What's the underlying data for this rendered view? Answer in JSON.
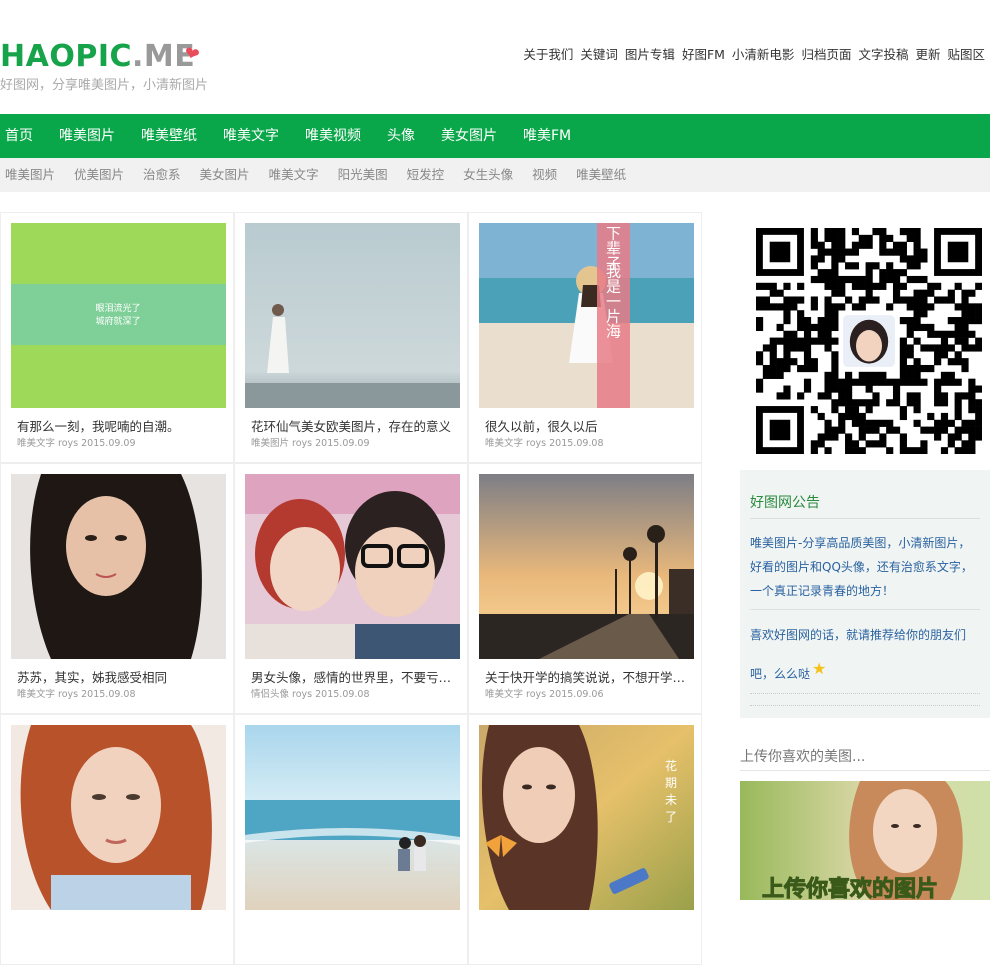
{
  "logo": {
    "brand": "HAOPIC",
    "dot_me": ".ME",
    "slogan": "好图网，分享唯美图片，小清新图片"
  },
  "top_links": [
    "关于我们",
    "关键词",
    "图片专辑",
    "好图FM",
    "小清新电影",
    "归档页面",
    "文字投稿",
    "更新",
    "贴图区"
  ],
  "main_nav": [
    "首页",
    "唯美图片",
    "唯美壁纸",
    "唯美文字",
    "唯美视频",
    "头像",
    "美女图片",
    "唯美FM"
  ],
  "sub_nav": [
    "唯美图片",
    "优美图片",
    "治愈系",
    "美女图片",
    "唯美文字",
    "阳光美图",
    "短发控",
    "女生头像",
    "视频",
    "唯美壁纸"
  ],
  "posts": [
    {
      "title": "有那么一刻，我呢喃的自潮。",
      "meta": "唯美文字 roys 2015.09.09",
      "thumb_text": [
        "眼泪流光了",
        "城府就深了"
      ]
    },
    {
      "title": "花环仙气美女欧美图片，存在的意义",
      "meta": "唯美图片 roys 2015.09.09"
    },
    {
      "title": "很久以前，很久以后",
      "meta": "唯美文字 roys 2015.09.08",
      "thumb_text": [
        "下辈子",
        "我是一片海"
      ]
    },
    {
      "title": "苏苏，其实，姊我感受相同",
      "meta": "唯美文字 roys 2015.09.08"
    },
    {
      "title": "男女头像，感情的世界里，不要亏待对你好的人",
      "meta": "情侣头像 roys 2015.09.08"
    },
    {
      "title": "关于快开学的搞笑说说，不想开学的心情说说",
      "meta": "唯美文字 roys 2015.09.06"
    },
    {
      "title": "",
      "meta": ""
    },
    {
      "title": "",
      "meta": ""
    },
    {
      "title": "",
      "meta": "",
      "thumb_text": [
        "花",
        "期",
        "未",
        "了"
      ]
    }
  ],
  "notice": {
    "heading": "好图网公告",
    "para1": "唯美图片-分享高品质美图，小清新图片，好看的图片和QQ头像，还有治愈系文字，一个真正记录青春的地方！",
    "para2": "喜欢好图网的话，就请推荐给你的朋友们吧，么么哒"
  },
  "upload": {
    "title": "上传你喜欢的美图...",
    "banner_text": "上传你喜欢的图片"
  },
  "colors": {
    "brand_green": "#0aa74a",
    "logo_gray": "#999999",
    "link_blue": "#2a62a0",
    "heart": "#e94b5a"
  }
}
